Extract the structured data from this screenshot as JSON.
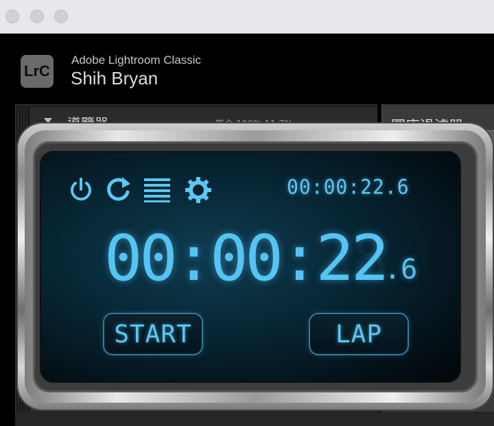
{
  "window": {
    "traffic_lights": [
      "close",
      "minimize",
      "zoom"
    ]
  },
  "lightroom": {
    "logo_text": "LrC",
    "app_name": "Adobe Lightroom Classic",
    "user_name": "Shih Bryan",
    "navigator_title": "導覽器",
    "navigator_options": "符合  100%  11.7%",
    "filter_title": "圖庫過濾器:"
  },
  "stopwatch": {
    "icons": [
      "power-icon",
      "reset-icon",
      "list-icon",
      "settings-icon"
    ],
    "small_time": "00:00:22.6",
    "big_time": "00:00:22",
    "big_time_ghost": "88:88:88",
    "big_tenths": ".6",
    "start_label": "START",
    "lap_label": "LAP",
    "accent_color": "#5cc7f2"
  }
}
